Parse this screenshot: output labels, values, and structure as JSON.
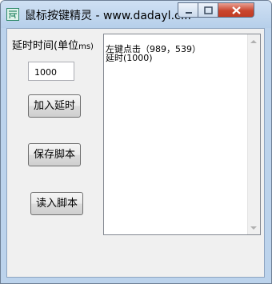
{
  "window": {
    "title": "鼠标按键精灵 - www.dadayl.c..."
  },
  "icons": {
    "app": "app-icon",
    "minimize": "minimize-icon",
    "maximize": "maximize-icon",
    "close": "close-icon"
  },
  "form": {
    "delay_label_main": "延时时间(单位",
    "delay_label_unit": "ms)",
    "delay_value": "1000",
    "add_delay_button": "加入延时",
    "save_script_button": "保存脚本",
    "load_script_button": "读入脚本"
  },
  "script_text": {
    "lines": [
      "左键点击（989，539）",
      "延时(1000)"
    ]
  },
  "colors": {
    "title_bar": "#bcd3ec",
    "close_button": "#c9452e",
    "client_bg": "#f0f0f0"
  }
}
